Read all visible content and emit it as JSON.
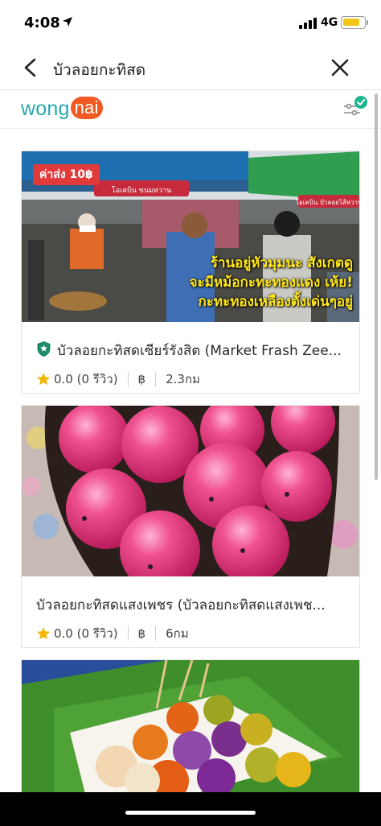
{
  "status_bar": {
    "time": "4:08",
    "network": "4G"
  },
  "nav": {
    "title": "บัวลอยกะทิสด"
  },
  "brand": {
    "logo_main": "wong",
    "logo_accent": "nai"
  },
  "cards": [
    {
      "title": "บัวลอยกะทิสดเซียร์รังสิต (Market Frash Zee...",
      "rating": "0.0 (0 รีวิว)",
      "price_symbol": "฿",
      "distance": "2.3กม",
      "delivery_badge": "ค่าส่ง 10฿",
      "overlay_line1": "ร้านอยู่หัวมุมนะ สังเกตดู",
      "overlay_line2": "จะมีหม้อกะทะทองแดง เห้ย!",
      "overlay_line3": "กะทะทองเหลืองตั้งเด่นๆอยู่",
      "sign_left": "โอเคบิน ขนมหวาน",
      "sign_right": "โอเคบิน บัวลอยไส้หวาน",
      "verified": true
    },
    {
      "title": "บัวลอยกะทิสดแสงเพชร (บัวลอยกะทิสดแสงเพช...",
      "rating": "0.0 (0 รีวิว)",
      "price_symbol": "฿",
      "distance": "6กม",
      "verified": false
    },
    {
      "title": "",
      "verified": false
    }
  ],
  "colors": {
    "brand_teal": "#2aa6ad",
    "brand_orange": "#f05a22",
    "star": "#f2b705",
    "verified_green": "#1e8a6a",
    "badge_red": "#e23a3a"
  },
  "icons": [
    "back-arrow-icon",
    "close-icon",
    "filter-icon",
    "checkmark-badge-icon",
    "verified-shield-icon",
    "star-icon",
    "location-arrow-icon",
    "signal-icon",
    "battery-icon"
  ]
}
